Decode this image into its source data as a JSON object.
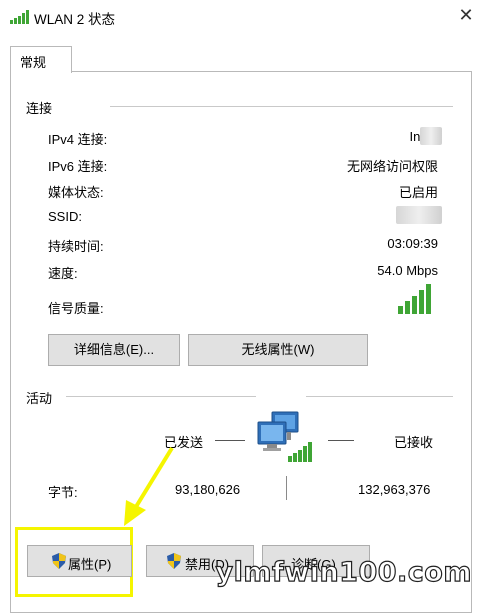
{
  "window": {
    "title": "WLAN 2 状态",
    "close_glyph": "✕"
  },
  "tabs": [
    {
      "label": "常规"
    }
  ],
  "connection": {
    "section_title": "连接",
    "rows": [
      {
        "label": "IPv4 连接:",
        "value": "Int"
      },
      {
        "label": "IPv6 连接:",
        "value": "无网络访问权限"
      },
      {
        "label": "媒体状态:",
        "value": "已启用"
      },
      {
        "label": "SSID:",
        "value": ""
      },
      {
        "label": "持续时间:",
        "value": "03:09:39"
      },
      {
        "label": "速度:",
        "value": "54.0 Mbps"
      },
      {
        "label": "信号质量:",
        "value": "",
        "signal_bars": 5
      }
    ],
    "details_button": "详细信息(E)...",
    "wireless_props_button": "无线属性(W)"
  },
  "activity": {
    "section_title": "活动",
    "sent_label": "已发送",
    "received_label": "已接收",
    "bytes_label": "字节:",
    "sent_bytes": "93,180,626",
    "received_bytes": "132,963,376"
  },
  "bottom_buttons": {
    "properties": "属性(P)",
    "disable": "禁用(D)",
    "diagnose": "诊断(G)"
  },
  "watermark": "ylmfwin100.com",
  "colors": {
    "signal_green": "#3fa535",
    "highlight_yellow": "#f5f500",
    "shield_blue": "#2b5ca8",
    "shield_yellow": "#f0c419"
  }
}
